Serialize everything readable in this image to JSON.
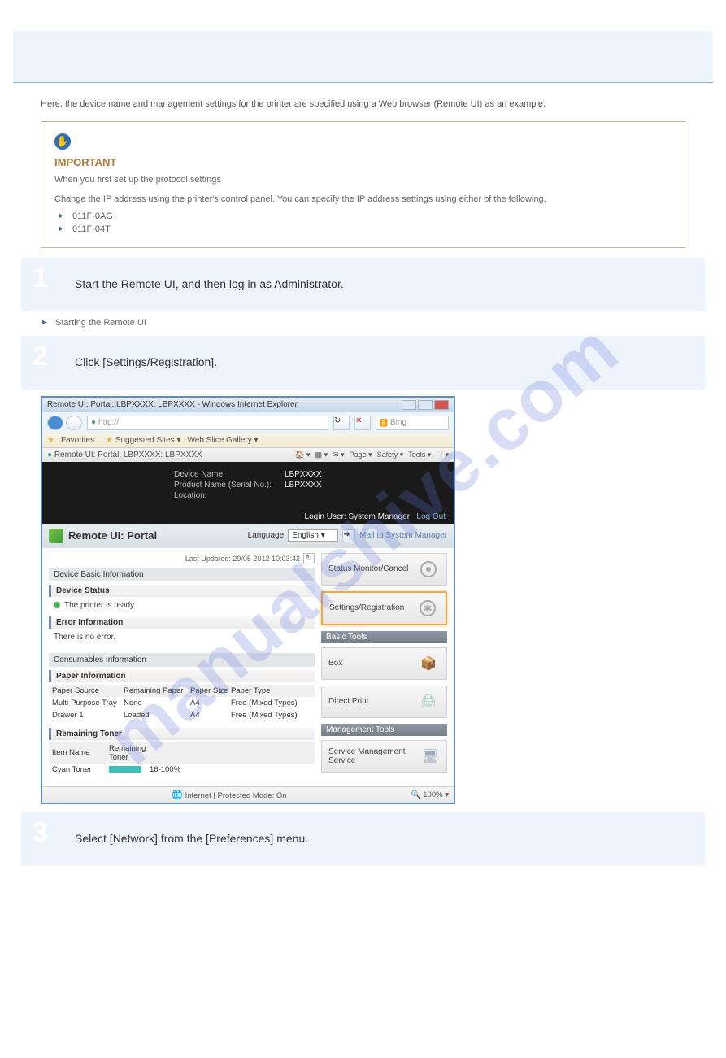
{
  "watermark": "manualshive.com",
  "intro_text": "Here, the device name and management settings for the printer are specified using a Web browser (Remote UI) as an example.",
  "important": {
    "heading": "IMPORTANT",
    "body": "When you first set up the protocol settings",
    "body2": "Change the IP address using the printer's control panel. You can specify the IP address settings using either of the following.",
    "items": [
      "011F-0AG",
      "011F-04T"
    ]
  },
  "step1": {
    "title": "Start the Remote UI, and then log in as Administrator.",
    "link": "Starting the Remote UI"
  },
  "step2": {
    "title": "Click [Settings/Registration]."
  },
  "step3": {
    "title": "Select [Network] from the [Preferences] menu."
  },
  "screenshot": {
    "titlebar": "Remote UI: Portal: LBPXXXX: LBPXXXX - Windows Internet Explorer",
    "addr_prefix": "http://",
    "search": "Bing",
    "favorites": "Favorites",
    "suggested": "Suggested Sites",
    "webslice": "Web Slice Gallery",
    "tab": "Remote UI: Portal: LBPXXXX: LBPXXXX",
    "tools": [
      "Page",
      "Safety",
      "Tools"
    ],
    "device_name_lbl": "Device Name:",
    "device_name_val": "LBPXXXX",
    "product_lbl": "Product Name (Serial No.):",
    "product_val": "LBPXXXX",
    "location_lbl": "Location:",
    "login_text": "Login User:",
    "login_user": "System Manager",
    "logout": "Log Out",
    "portal_title": "Remote UI: Portal",
    "language_lbl": "Language",
    "language_val": "English",
    "mail_link": "Mail to System Manager",
    "last_updated": "Last Updated: 29/05 2012 10:03:42",
    "basic_info": "Device Basic Information",
    "device_status": "Device Status",
    "printer_ready": "The printer is ready.",
    "error_info": "Error Information",
    "no_error": "There is no error.",
    "consumables": "Consumables Information",
    "paper_info": "Paper Information",
    "paper_headers": [
      "Paper Source",
      "Remaining Paper",
      "Paper Size",
      "Paper Type"
    ],
    "paper_rows": [
      [
        "Multi-Purpose Tray",
        "None",
        "A4",
        "Free (Mixed Types)"
      ],
      [
        "Drawer 1",
        "Loaded",
        "A4",
        "Free (Mixed Types)"
      ]
    ],
    "remaining_toner": "Remaining Toner",
    "toner_headers": [
      "Item Name",
      "Remaining Toner"
    ],
    "toner_item": "Cyan Toner",
    "toner_pct": "16-100%",
    "status_monitor": "Status Monitor/Cancel",
    "settings_reg": "Settings/Registration",
    "basic_tools": "Basic Tools",
    "box": "Box",
    "direct_print": "Direct Print",
    "mgmt_tools": "Management Tools",
    "sms": "Service Management Service",
    "protected_mode": "Internet | Protected Mode: On",
    "zoom": "100%"
  }
}
